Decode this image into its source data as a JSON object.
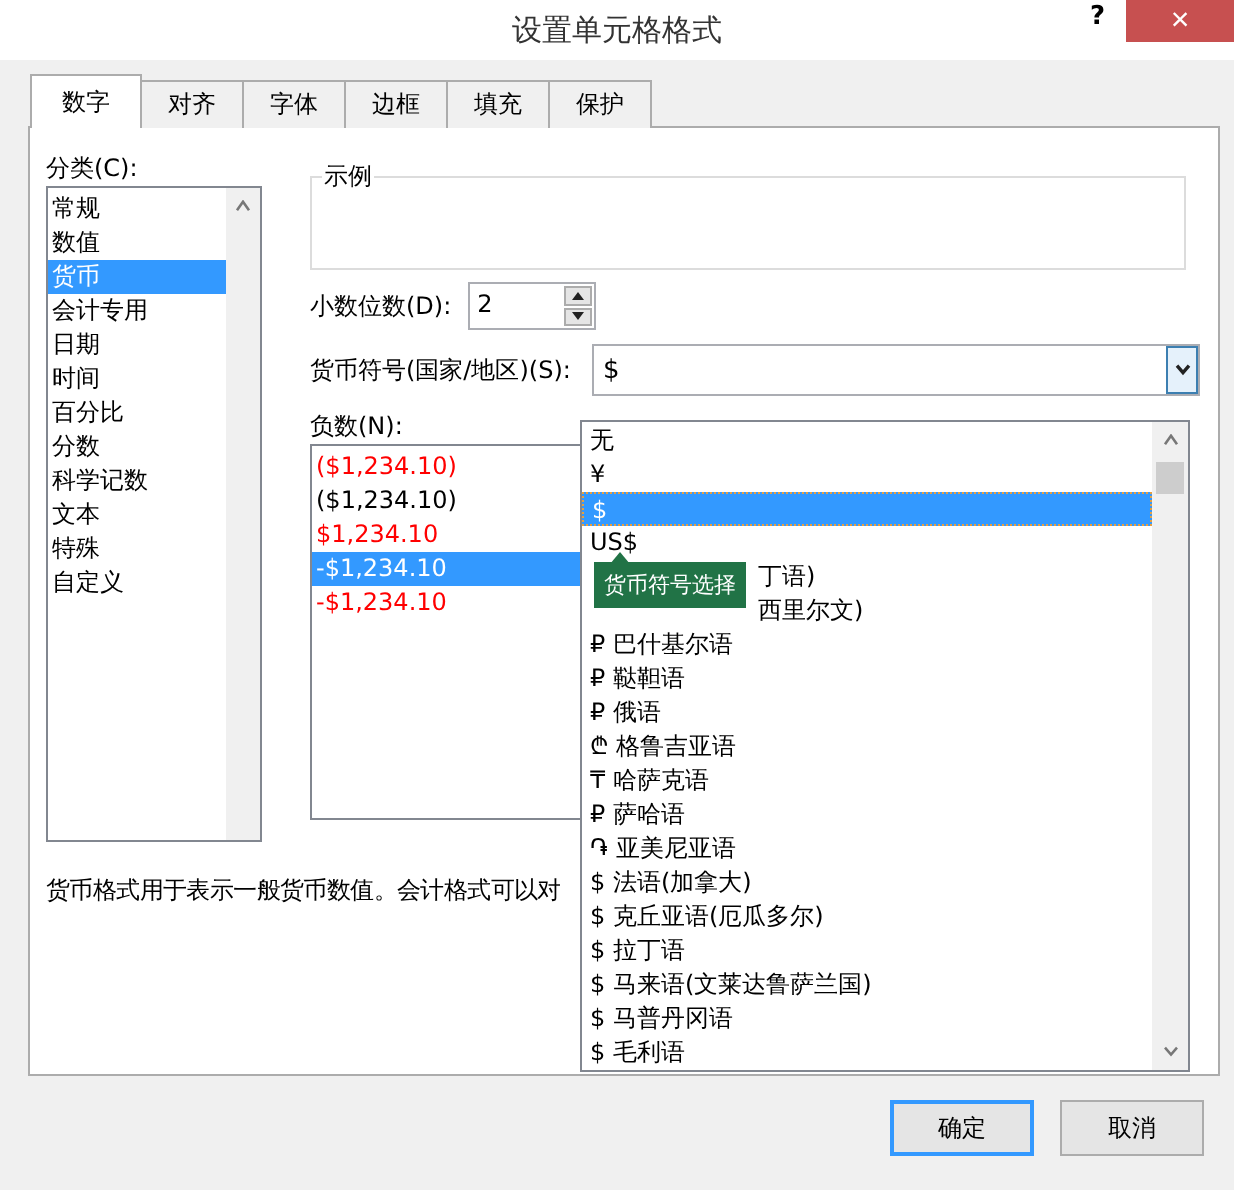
{
  "window": {
    "title": "设置单元格格式",
    "help": "?",
    "close": "×"
  },
  "tabs": [
    {
      "label": "数字",
      "selected": true
    },
    {
      "label": "对齐",
      "selected": false
    },
    {
      "label": "字体",
      "selected": false
    },
    {
      "label": "边框",
      "selected": false
    },
    {
      "label": "填充",
      "selected": false
    },
    {
      "label": "保护",
      "selected": false
    }
  ],
  "category": {
    "label": "分类(C):",
    "items": [
      {
        "label": "常规",
        "selected": false
      },
      {
        "label": "数值",
        "selected": false
      },
      {
        "label": "货币",
        "selected": true
      },
      {
        "label": "会计专用",
        "selected": false
      },
      {
        "label": "日期",
        "selected": false
      },
      {
        "label": "时间",
        "selected": false
      },
      {
        "label": "百分比",
        "selected": false
      },
      {
        "label": "分数",
        "selected": false
      },
      {
        "label": "科学记数",
        "selected": false
      },
      {
        "label": "文本",
        "selected": false
      },
      {
        "label": "特殊",
        "selected": false
      },
      {
        "label": "自定义",
        "selected": false
      }
    ]
  },
  "sample": {
    "label": "示例"
  },
  "decimal_places": {
    "label": "小数位数(D):",
    "value": "2"
  },
  "currency_symbol": {
    "label": "货币符号(国家/地区)(S):",
    "value": "$",
    "expanded": true,
    "options": [
      {
        "text": "无",
        "selected": false,
        "kind": "plain"
      },
      {
        "text": "¥",
        "selected": false,
        "kind": "plain"
      },
      {
        "text": "$",
        "selected": true,
        "kind": "plain"
      },
      {
        "text": "US$",
        "selected": false,
        "kind": "plain"
      },
      {
        "text": "丁语)",
        "selected": false,
        "kind": "covered"
      },
      {
        "text": "西里尔文)",
        "selected": false,
        "kind": "covered"
      },
      {
        "text": "₽ 巴什基尔语",
        "selected": false,
        "kind": "plain"
      },
      {
        "text": "₽ 鞑靼语",
        "selected": false,
        "kind": "plain"
      },
      {
        "text": "₽ 俄语",
        "selected": false,
        "kind": "plain"
      },
      {
        "text": "₾ 格鲁吉亚语",
        "selected": false,
        "kind": "plain"
      },
      {
        "text": "₸ 哈萨克语",
        "selected": false,
        "kind": "plain"
      },
      {
        "text": "₽ 萨哈语",
        "selected": false,
        "kind": "plain"
      },
      {
        "text": "֏ 亚美尼亚语",
        "selected": false,
        "kind": "plain"
      },
      {
        "text": "$ 法语(加拿大)",
        "selected": false,
        "kind": "plain"
      },
      {
        "text": "$ 克丘亚语(厄瓜多尔)",
        "selected": false,
        "kind": "plain"
      },
      {
        "text": "$ 拉丁语",
        "selected": false,
        "kind": "plain"
      },
      {
        "text": "$ 马来语(文莱达鲁萨兰国)",
        "selected": false,
        "kind": "plain"
      },
      {
        "text": "$ 马普丹冈语",
        "selected": false,
        "kind": "plain"
      },
      {
        "text": "$ 毛利语",
        "selected": false,
        "kind": "plain"
      }
    ],
    "tooltip": "货币符号选择"
  },
  "negative_numbers": {
    "label": "负数(N):",
    "items": [
      {
        "text": "($1,234.10)",
        "color": "#ff0000",
        "selected": false
      },
      {
        "text": "($1,234.10)",
        "color": "#000000",
        "selected": false
      },
      {
        "text": "$1,234.10",
        "color": "#ff0000",
        "selected": false
      },
      {
        "text": "-$1,234.10",
        "selected": true
      },
      {
        "text": "-$1,234.10",
        "color": "#ff0000",
        "selected": false
      }
    ]
  },
  "description": "货币格式用于表示一般货币数值。会计格式可以对",
  "buttons": [
    {
      "label": "确定",
      "default": true
    },
    {
      "label": "取消",
      "default": false
    }
  ]
}
